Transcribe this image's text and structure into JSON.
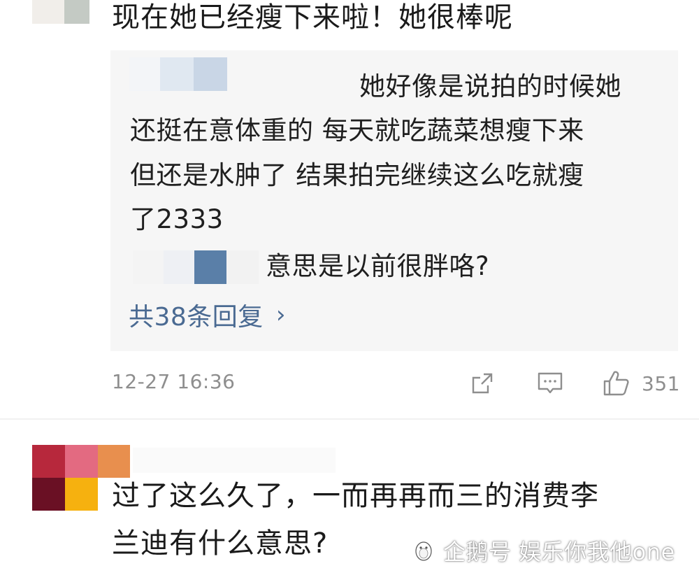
{
  "comment1": {
    "text": "现在她已经瘦下来啦！她很棒呢",
    "replies": {
      "reply1_line1": "她好像是说拍的时候她",
      "reply1_line2": "还挺在意体重的 每天就吃蔬菜想瘦下来",
      "reply1_line3": "但还是水肿了 结果拍完继续这么吃就瘦",
      "reply1_line4": "了2333",
      "reply2": "意思是以前很胖咯?",
      "more_label": "共38条回复",
      "more_chevron": "›"
    },
    "timestamp": "12-27 16:36",
    "like_count": "351",
    "icons": [
      "share-icon",
      "reply-icon",
      "like-icon"
    ]
  },
  "comment2": {
    "line1": "过了这么久了，一而再再而三的消费李",
    "line2": "兰迪有什么意思?"
  },
  "watermark": {
    "text": "企鹅号 娱乐你我他one"
  }
}
